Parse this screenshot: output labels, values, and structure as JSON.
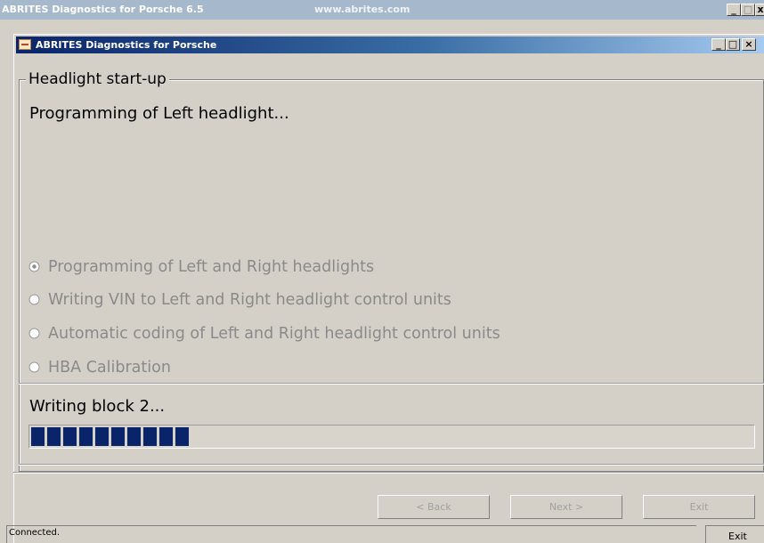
{
  "outer_window": {
    "title": "ABRITES Diagnostics for Porsche 6.5",
    "url": "www.abrites.com",
    "minimize": "_",
    "maximize": "□",
    "close": "x"
  },
  "inner_window": {
    "title": "ABRITES Diagnostics for Porsche",
    "minimize": "_",
    "maximize": "□",
    "close": "×"
  },
  "group": {
    "legend": "Headlight start-up",
    "heading": "Programming of Left headlight..."
  },
  "options": [
    {
      "label": "Programming of Left and Right headlights",
      "selected": true
    },
    {
      "label": "Writing VIN to Left and Right headlight  control units",
      "selected": false
    },
    {
      "label": "Automatic coding of Left and Right headlight  control units",
      "selected": false
    },
    {
      "label": "HBA Calibration",
      "selected": false
    }
  ],
  "progress": {
    "status": "Writing block 2...",
    "value": 0.224,
    "color": "#0a246a"
  },
  "buttons": {
    "back": "< Back",
    "next": "Next >",
    "exit": "Exit"
  },
  "statusbar": {
    "connection": "Connected.",
    "exit": "Exit"
  }
}
